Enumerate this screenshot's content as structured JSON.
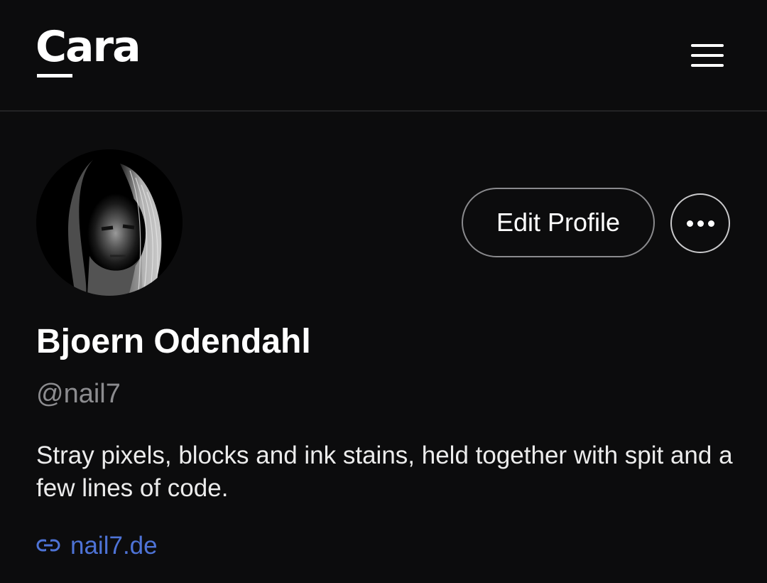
{
  "header": {
    "logo": "Cara",
    "menu_icon": "hamburger-menu-icon"
  },
  "profile": {
    "name": "Bjoern Odendahl",
    "handle": "@nail7",
    "bio": "Stray pixels, blocks and ink stains, held together with spit and a few lines of code.",
    "website": "nail7.de",
    "website_icon": "link-icon",
    "edit_label": "Edit Profile",
    "more_icon": "more-horizontal-icon"
  },
  "colors": {
    "background": "#0c0c0d",
    "text": "#ffffff",
    "muted": "#8c8c8f",
    "link": "#4e73d6"
  }
}
